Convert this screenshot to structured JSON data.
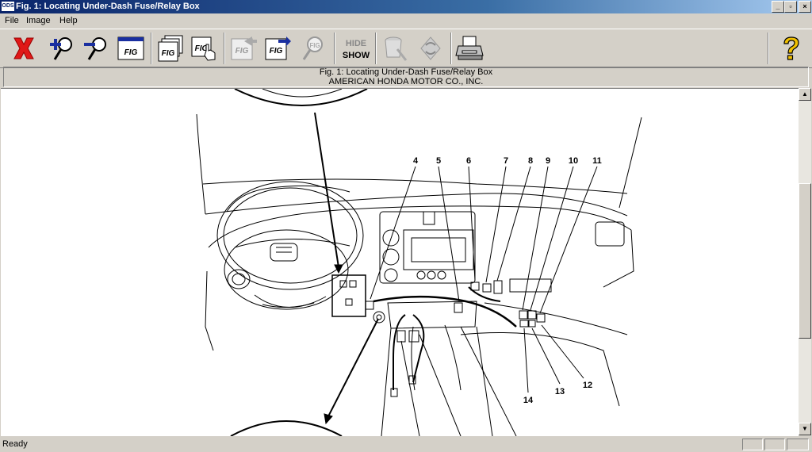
{
  "window": {
    "title": "Fig. 1: Locating Under-Dash Fuse/Relay Box",
    "app_icon_label": "ODS",
    "controls": {
      "minimize": "_",
      "maximize": "▫",
      "close": "×"
    }
  },
  "menu": {
    "items": [
      "File",
      "Image",
      "Help"
    ]
  },
  "toolbar": {
    "buttons": [
      {
        "name": "close-figure-button",
        "icon": "red-x-icon",
        "enabled": true
      },
      {
        "name": "zoom-in-button",
        "icon": "zoom-in-icon",
        "enabled": true
      },
      {
        "name": "zoom-out-button",
        "icon": "zoom-out-icon",
        "enabled": true
      },
      {
        "name": "fit-window-button",
        "icon": "fig-window-icon",
        "enabled": true
      },
      {
        "name": "figure-list-button",
        "icon": "fig-stack-icon",
        "enabled": true
      },
      {
        "name": "figure-select-button",
        "icon": "fig-hand-icon",
        "enabled": true
      },
      {
        "name": "previous-figure-button",
        "icon": "fig-prev-icon",
        "enabled": false
      },
      {
        "name": "next-figure-button",
        "icon": "fig-next-icon",
        "enabled": true
      },
      {
        "name": "figure-zoom-button",
        "icon": "fig-magnifier-icon",
        "enabled": false
      },
      {
        "name": "hide-show-button",
        "icon": "hide-show-icon",
        "enabled": true
      },
      {
        "name": "erase-button",
        "icon": "eraser-icon",
        "enabled": false
      },
      {
        "name": "rotate-button",
        "icon": "rotate-icon",
        "enabled": false
      },
      {
        "name": "print-button",
        "icon": "printer-icon",
        "enabled": true
      },
      {
        "name": "help-button",
        "icon": "question-icon",
        "enabled": true
      }
    ],
    "hide_label": "HIDE",
    "show_label": "SHOW",
    "fig_label": "FIG"
  },
  "caption": {
    "line1": "Fig. 1: Locating Under-Dash Fuse/Relay Box",
    "line2": "AMERICAN HONDA MOTOR CO., INC."
  },
  "diagram": {
    "callouts": [
      "4",
      "5",
      "6",
      "7",
      "8",
      "9",
      "10",
      "11",
      "12",
      "13",
      "14"
    ]
  },
  "status": {
    "text": "Ready"
  },
  "colors": {
    "title_start": "#0a246a",
    "title_end": "#a6caf0",
    "chrome": "#d4d0c8",
    "close_x": "#e01818",
    "help": "#f0c000"
  }
}
